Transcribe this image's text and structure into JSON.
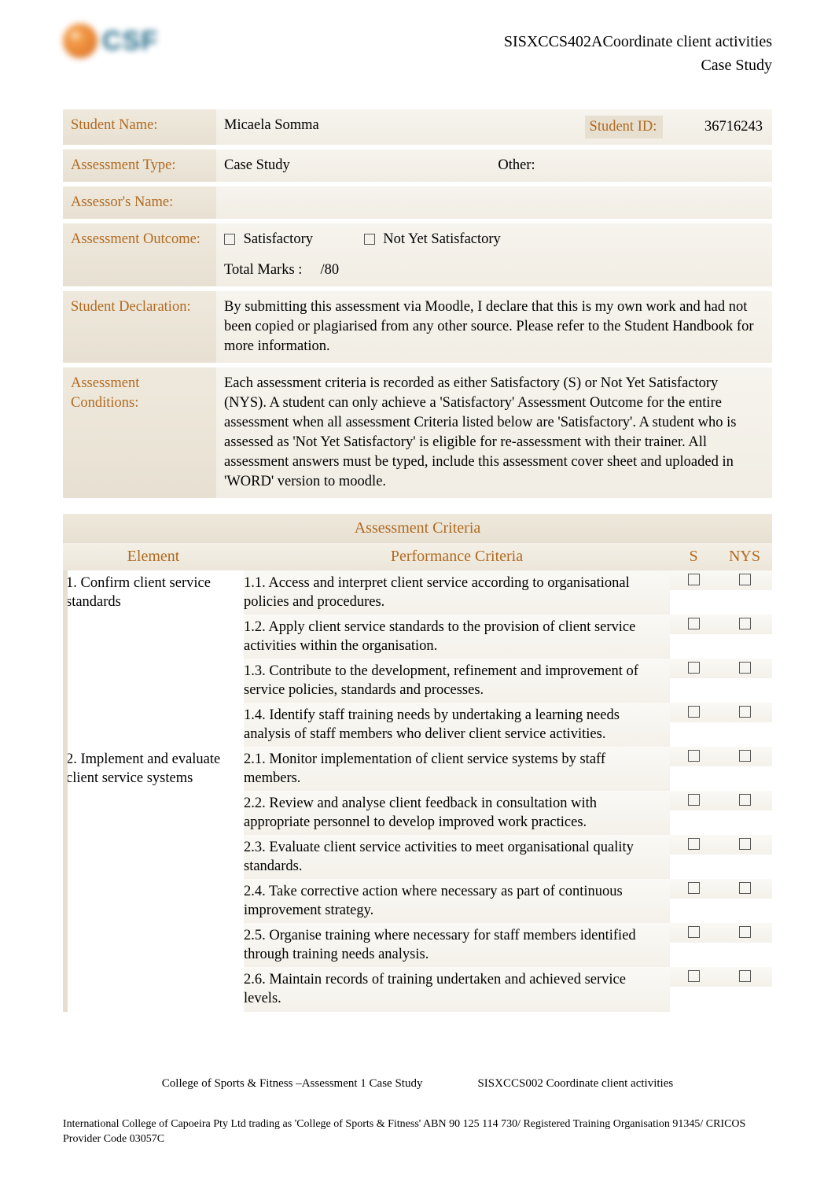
{
  "header": {
    "course_code_title": "SISXCCS402ACoordinate client activities",
    "doc_type": "Case Study"
  },
  "fields": {
    "student_name": {
      "label": "Student Name:",
      "value": "Micaela Somma"
    },
    "student_id": {
      "label": "Student ID:",
      "value": "36716243"
    },
    "assessment_type": {
      "label": "Assessment Type:",
      "value": "Case Study",
      "other_label": "Other:"
    },
    "assessor_name": {
      "label": "Assessor's Name:",
      "value": ""
    },
    "assessment_outcome": {
      "label": "Assessment Outcome:",
      "satisfactory_label": "Satisfactory",
      "not_yet_label": "Not Yet Satisfactory",
      "total_marks_label": "Total Marks :",
      "total_marks_value": "/80"
    },
    "student_declaration": {
      "label": "Student Declaration:",
      "text": "By submitting this assessment via Moodle, I declare that this is my own work and had not been copied or plagiarised from any other source. Please refer to the Student Handbook for more information."
    },
    "assessment_conditions": {
      "label": "Assessment Conditions:",
      "text": "Each assessment criteria is recorded as either Satisfactory (S) or Not Yet Satisfactory (NYS). A student can only achieve a 'Satisfactory' Assessment Outcome for the entire assessment when all assessment Criteria listed below are 'Satisfactory'. A student who is assessed as 'Not Yet Satisfactory' is eligible for re-assessment with their trainer. All assessment answers must be typed, include this assessment cover sheet and uploaded in 'WORD' version to moodle."
    }
  },
  "criteria": {
    "title": "Assessment Criteria",
    "col_element": "Element",
    "col_pc": "Performance Criteria",
    "col_s": "S",
    "col_nys": "NYS",
    "rows": [
      {
        "element": "1. Confirm client service standards",
        "pc": "1.1. Access and interpret client service according to organisational policies and procedures."
      },
      {
        "element": "",
        "pc": "1.2. Apply client service standards to the provision of client service activities within the organisation."
      },
      {
        "element": "",
        "pc": "1.3. Contribute to the development, refinement and improvement of service policies, standards and processes."
      },
      {
        "element": "",
        "pc": "1.4. Identify staff training needs by undertaking a learning needs analysis of staff members who deliver client service activities."
      },
      {
        "element": "2. Implement and evaluate client service systems",
        "pc": "2.1. Monitor implementation of client service systems by staff members."
      },
      {
        "element": "",
        "pc": "2.2. Review and analyse client feedback in consultation with appropriate personnel to develop improved work practices."
      },
      {
        "element": "",
        "pc": "2.3. Evaluate client service activities to meet organisational quality standards."
      },
      {
        "element": "",
        "pc": "2.4. Take corrective action where necessary as part of continuous improvement strategy."
      },
      {
        "element": "",
        "pc": "2.5. Organise training where necessary for staff members identified through training needs analysis."
      },
      {
        "element": "",
        "pc": "2.6. Maintain records of training undertaken and achieved service levels."
      }
    ]
  },
  "footer": {
    "mid_left": "College of Sports & Fitness –Assessment 1 Case Study",
    "mid_right": "SISXCCS002 Coordinate client activities",
    "bottom": "International College of Capoeira Pty Ltd trading as 'College of Sports & Fitness' ABN 90 125 114 730/ Registered Training Organisation 91345/ CRICOS Provider Code 03057C"
  }
}
